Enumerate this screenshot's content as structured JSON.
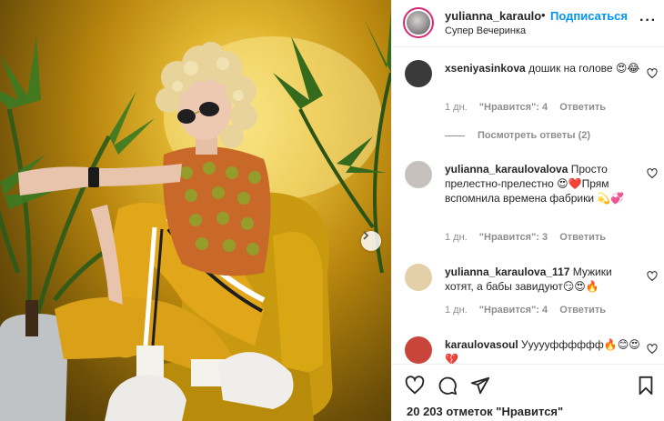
{
  "post": {
    "username": "yulianna_karaulo",
    "separator": "•",
    "follow_label": "Подписаться",
    "subtitle": "Супер Вечеринка",
    "more_label": "···"
  },
  "comments": [
    {
      "username": "xseniyasinkova",
      "text": "дошик на голове 😍😂",
      "age": "1 дн.",
      "likes": "\"Нравится\": 4",
      "reply": "Ответить",
      "avatar_color": "#3a3a3a"
    },
    {
      "username": "yulianna_karaulovalova",
      "text": "Просто прелестно-прелестно 😍❤️Прям вспомнила времена фабрики 💫💞",
      "age": "1 дн.",
      "likes": "\"Нравится\": 3",
      "reply": "Ответить",
      "avatar_color": "#c7c1bd"
    },
    {
      "username": "yulianna_karaulova_117",
      "text": "Мужики хотят, а бабы завидуют😏😍🔥",
      "age": "1 дн.",
      "likes": "\"Нравится\": 4",
      "reply": "Ответить",
      "avatar_color": "#e3cfa8"
    },
    {
      "username": "karaulovasoul",
      "text": "Уууууфффффф🔥😊😍💔",
      "avatar_color": "#c9443b"
    }
  ],
  "view_replies": "Посмотреть ответы (2)",
  "likes_count": "20 203 отметок \"Нравится\"",
  "icons": [
    "like-heart-icon",
    "comment-icon",
    "share-icon",
    "bookmark-icon",
    "next-chevron-icon",
    "comment-heart-icon"
  ],
  "colors": {
    "accent": "#0095f6",
    "text": "#262626",
    "muted": "#8e8e8e",
    "border": "#efefef"
  }
}
